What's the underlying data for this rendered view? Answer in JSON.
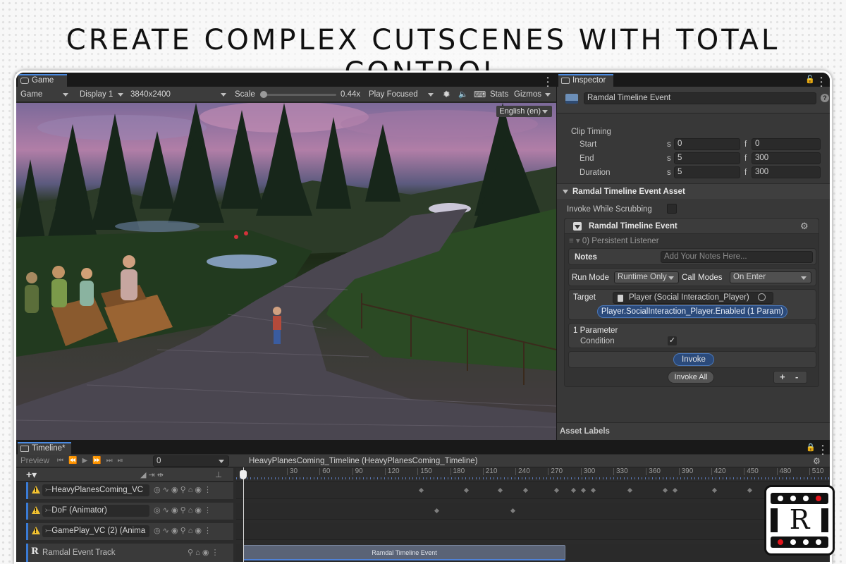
{
  "headline": "CREATE COMPLEX CUTSCENES WITH TOTAL CONTROL",
  "game": {
    "tab_label": "Game",
    "toolbar": {
      "mode": "Game",
      "display": "Display 1",
      "resolution": "3840x2400",
      "scale_label": "Scale",
      "scale_value": "0.44x",
      "play_mode": "Play Focused",
      "stats": "Stats",
      "gizmos": "Gizmos"
    },
    "language": "English (en)"
  },
  "inspector": {
    "tab_label": "Inspector",
    "object_name": "Ramdal Timeline Event",
    "clip_timing": {
      "header": "Clip Timing",
      "rows": [
        {
          "label": "Start",
          "s_unit": "s",
          "s_value": "0",
          "f_unit": "f",
          "f_value": "0"
        },
        {
          "label": "End",
          "s_unit": "s",
          "s_value": "5",
          "f_unit": "f",
          "f_value": "300"
        },
        {
          "label": "Duration",
          "s_unit": "s",
          "s_value": "5",
          "f_unit": "f",
          "f_value": "300"
        }
      ]
    },
    "asset_header": "Ramdal Timeline Event Asset",
    "invoke_scrubbing_label": "Invoke While Scrubbing",
    "event": {
      "title": "Ramdal Timeline Event",
      "listener": "0) Persistent Listener",
      "notes_label": "Notes",
      "notes_placeholder": "Add Your Notes Here...",
      "run_mode_label": "Run Mode",
      "run_mode_value": "Runtime Only",
      "call_modes_label": "Call Modes",
      "call_modes_value": "On Enter",
      "target_label": "Target",
      "target_value": "Player (Social Interaction_Player)",
      "method": "Player.SocialInteraction_Player.Enabled (1 Param)",
      "param_header": "1 Parameter",
      "param_label": "Condition",
      "condition_checked": true,
      "invoke_label": "Invoke",
      "invoke_all_label": "Invoke All",
      "plus": "+",
      "minus": "-"
    },
    "asset_labels": "Asset Labels"
  },
  "timeline": {
    "tab_label": "Timeline*",
    "preview_label": "Preview",
    "frame_value": "0",
    "breadcrumb": "HeavyPlanesComing_Timeline (HeavyPlanesComing_Timeline)",
    "ruler_labels": [
      "30",
      "60",
      "90",
      "120",
      "150",
      "180",
      "210",
      "240",
      "270",
      "300",
      "330",
      "360",
      "390",
      "420",
      "450",
      "480",
      "510"
    ],
    "tracks": [
      {
        "name": "HeavyPlanesComing_VC",
        "warning": true
      },
      {
        "name": "DoF (Animator)",
        "warning": true
      },
      {
        "name": "GamePlay_VC (2) (Anima",
        "warning": true
      },
      {
        "name": "Ramdal Event Track",
        "warning": false
      }
    ],
    "clip_label": "Ramdal Timeline Event"
  },
  "logo_letter": "R",
  "colors": {
    "accent_blue": "#3a7bd5",
    "warning_yellow": "#f3c231",
    "method_pill": "#2b4a7a"
  }
}
